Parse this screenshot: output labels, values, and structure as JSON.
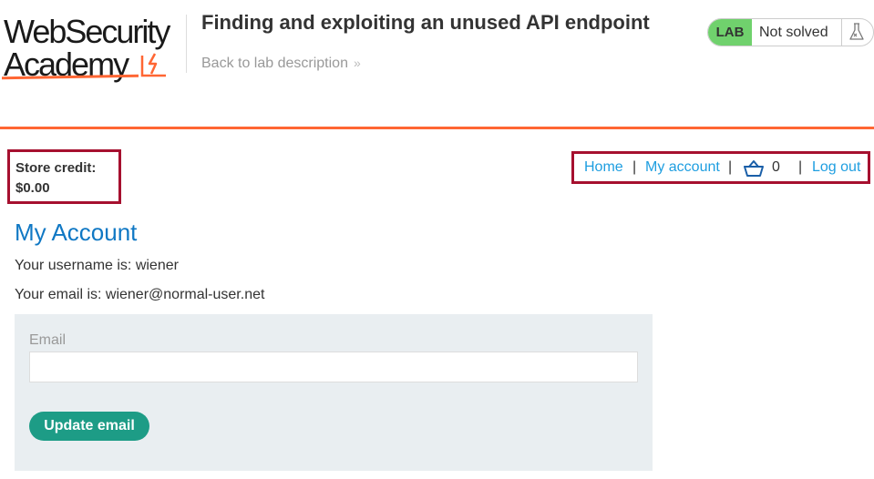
{
  "header": {
    "logo_line1": "WebSecurity",
    "logo_line2": "Academy",
    "lab_title": "Finding and exploiting an unused API endpoint",
    "back_link": "Back to lab description",
    "back_chevron": "»",
    "status_badge": "LAB",
    "status_text": "Not solved",
    "accent_color": "#ff6633",
    "badge_color": "#70d16d"
  },
  "store_credit": {
    "label": "Store credit:",
    "value": "$0.00"
  },
  "nav": {
    "home": "Home",
    "my_account": "My account",
    "cart_count": "0",
    "log_out": "Log out",
    "separator": "|",
    "link_color": "#1e9ee0",
    "highlight_color": "#a6102f"
  },
  "account": {
    "heading": "My Account",
    "username_line": "Your username is: wiener",
    "email_line": "Your email is: wiener@normal-user.net"
  },
  "email_form": {
    "label": "Email",
    "value": "",
    "button_label": "Update email",
    "button_color": "#1d9c86"
  }
}
